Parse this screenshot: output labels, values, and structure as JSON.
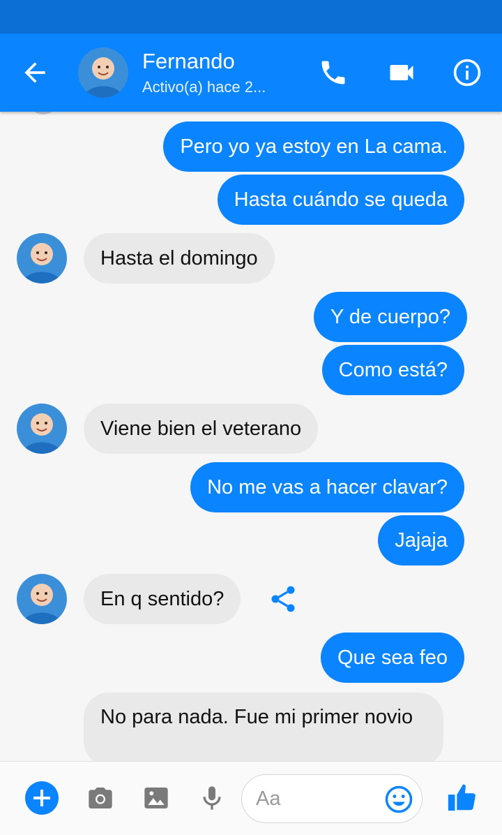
{
  "colors": {
    "accent": "#0a84ff",
    "status_bar": "#0c6fd6",
    "incoming_bubble": "#e9e9e9",
    "background": "#f6f6f6"
  },
  "header": {
    "contact_name": "Fernando",
    "status": "Activo(a) hace 2...",
    "icons": [
      "arrow-back-icon",
      "phone-icon",
      "video-camera-icon",
      "info-icon"
    ]
  },
  "messages": [
    {
      "direction": "out",
      "text": "Pero yo ya estoy en La cama."
    },
    {
      "direction": "out",
      "text": "Hasta cuándo se queda"
    },
    {
      "direction": "in",
      "text": "Hasta el domingo"
    },
    {
      "direction": "out",
      "text": "Y de cuerpo?"
    },
    {
      "direction": "out",
      "text": "Como está?"
    },
    {
      "direction": "in",
      "text": "Viene bien el veterano"
    },
    {
      "direction": "out",
      "text": "No me vas a hacer clavar?"
    },
    {
      "direction": "out",
      "text": "Jajaja"
    },
    {
      "direction": "in",
      "text": "En q sentido?"
    },
    {
      "direction": "out",
      "text": "Que sea feo"
    },
    {
      "direction": "in",
      "text": "No para nada. Fue mi primer novio"
    }
  ],
  "composer": {
    "placeholder": "Aa",
    "icons": [
      "plus-icon",
      "camera-icon",
      "gallery-icon",
      "microphone-icon",
      "emoji-icon",
      "thumbs-up-icon"
    ]
  }
}
